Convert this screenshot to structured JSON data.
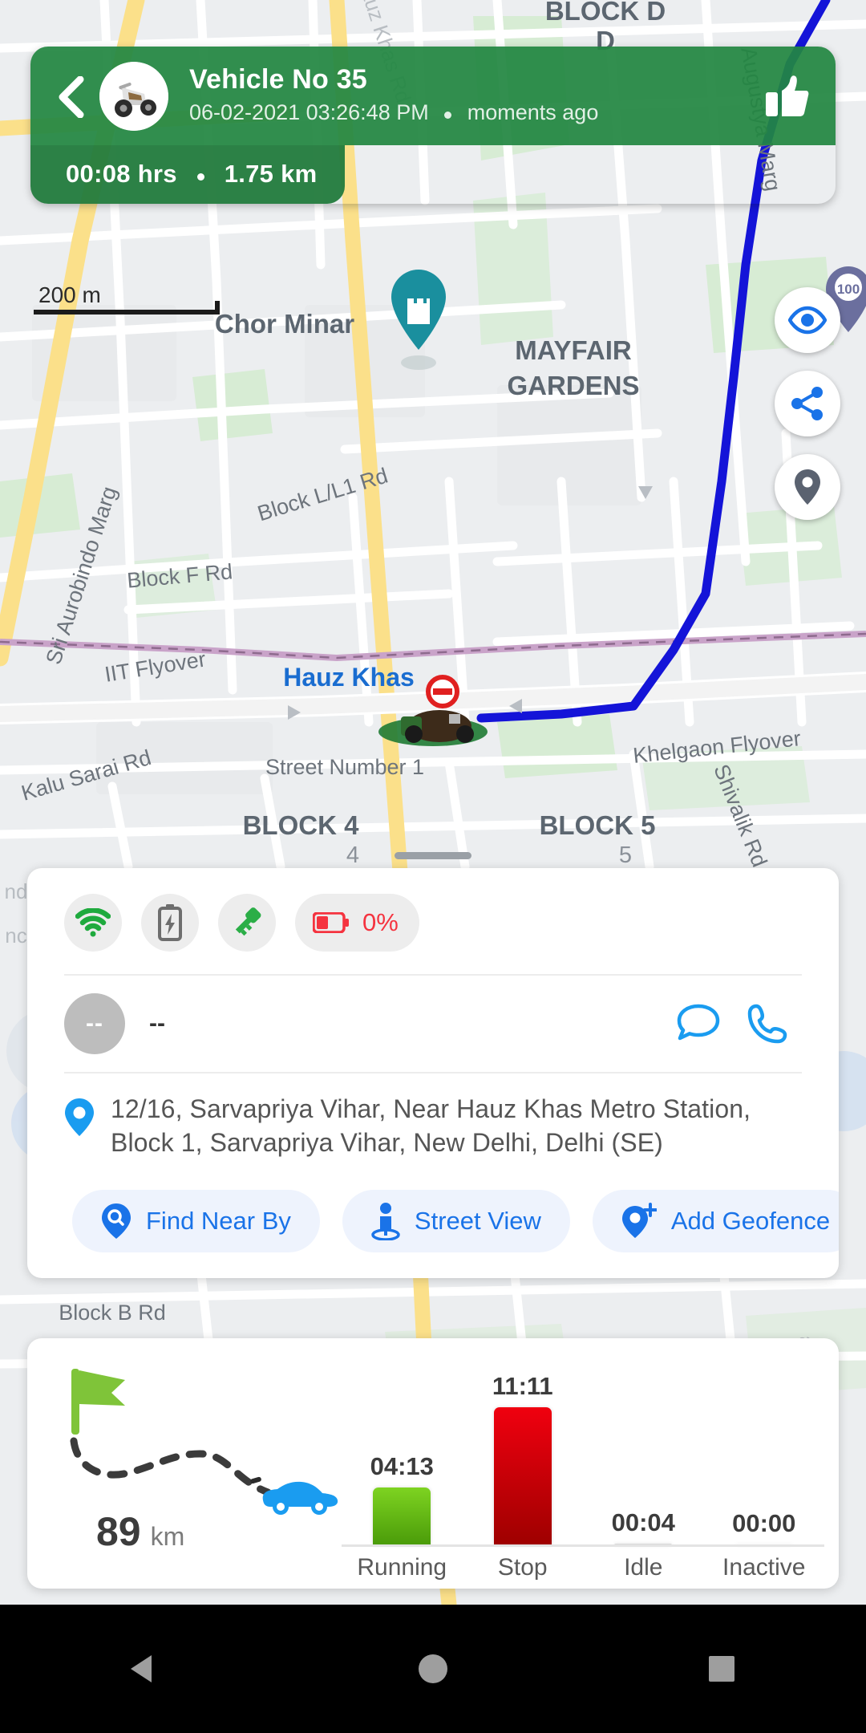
{
  "header": {
    "back_icon": "chevron-left-icon",
    "avatar_icon": "scooter-avatar",
    "vehicle_name": "Vehicle No 35",
    "timestamp": "06-02-2021 03:26:48 PM",
    "relative_time": "moments ago",
    "thumbs_icon": "thumbs-up-icon",
    "duration": "00:08 hrs",
    "distance": "1.75 km",
    "bg_color": "#228642"
  },
  "map": {
    "scale_label": "200 m",
    "fabs": [
      {
        "name": "eye-icon",
        "label": "Visibility"
      },
      {
        "name": "share-icon",
        "label": "Share"
      },
      {
        "name": "location-pin-icon",
        "label": "Location"
      }
    ],
    "labels": [
      "BLOCK D",
      "MAYFAIR",
      "GARDENS",
      "Chor Minar",
      "Hauz Khas",
      "Block L/L1 Rd",
      "Block F Rd",
      "IIT Flyover",
      "Sri Aurobindo Marg",
      "Kalu Sarai Rd",
      "Street Number 1",
      "BLOCK 4",
      "BLOCK 5",
      "Khelgaon Flyover",
      "Augustya Marg",
      "Shivalik Rd",
      "Block B Rd",
      "Hauz Khas Rd"
    ],
    "route_color": "#1414d8",
    "marker_icon": "vehicle-marker"
  },
  "info_card": {
    "status_icons": [
      {
        "name": "wifi-icon",
        "state": "green"
      },
      {
        "name": "battery-charging-icon",
        "state": "gray"
      },
      {
        "name": "key-icon",
        "state": "green"
      },
      {
        "name": "battery-low-icon",
        "state": "red"
      }
    ],
    "battery_percent": "0%",
    "driver": {
      "avatar_initials": "--",
      "name": "--",
      "chat_icon": "chat-bubble-icon",
      "call_icon": "phone-icon"
    },
    "address_icon": "map-pin-icon",
    "address": "12/16, Sarvapriya Vihar, Near Hauz Khas Metro Station, Block 1, Sarvapriya Vihar, New Delhi, Delhi (SE)",
    "actions": [
      {
        "label": "Find Near By",
        "icon": "search-pin-icon"
      },
      {
        "label": "Street View",
        "icon": "pegman-icon"
      },
      {
        "label": "Add Geofence",
        "icon": "add-geofence-icon"
      }
    ],
    "accent_color": "#1a73e8"
  },
  "chart_data": {
    "type": "bar",
    "title": "",
    "categories": [
      "Running",
      "Stop",
      "Idle",
      "Inactive"
    ],
    "value_labels": [
      "04:13",
      "11:11",
      "00:04",
      "00:00"
    ],
    "values": [
      4.217,
      11.183,
      0.067,
      0
    ],
    "units": "hh:mm",
    "colors": [
      "#6dbd18",
      "#c40000",
      "#9e9e9e",
      "#9e9e9e"
    ],
    "xlabel": "",
    "ylabel": "",
    "ylim": [
      0,
      11.183
    ],
    "grid": false,
    "legend": "none",
    "summary": {
      "distance_value": "89",
      "distance_unit": "km",
      "start_icon": "green-flag-icon",
      "end_icon": "car-icon",
      "path_style": "dashed"
    }
  },
  "navbar": {
    "back": "back-triangle-icon",
    "home": "home-circle-icon",
    "recents": "recents-square-icon"
  }
}
